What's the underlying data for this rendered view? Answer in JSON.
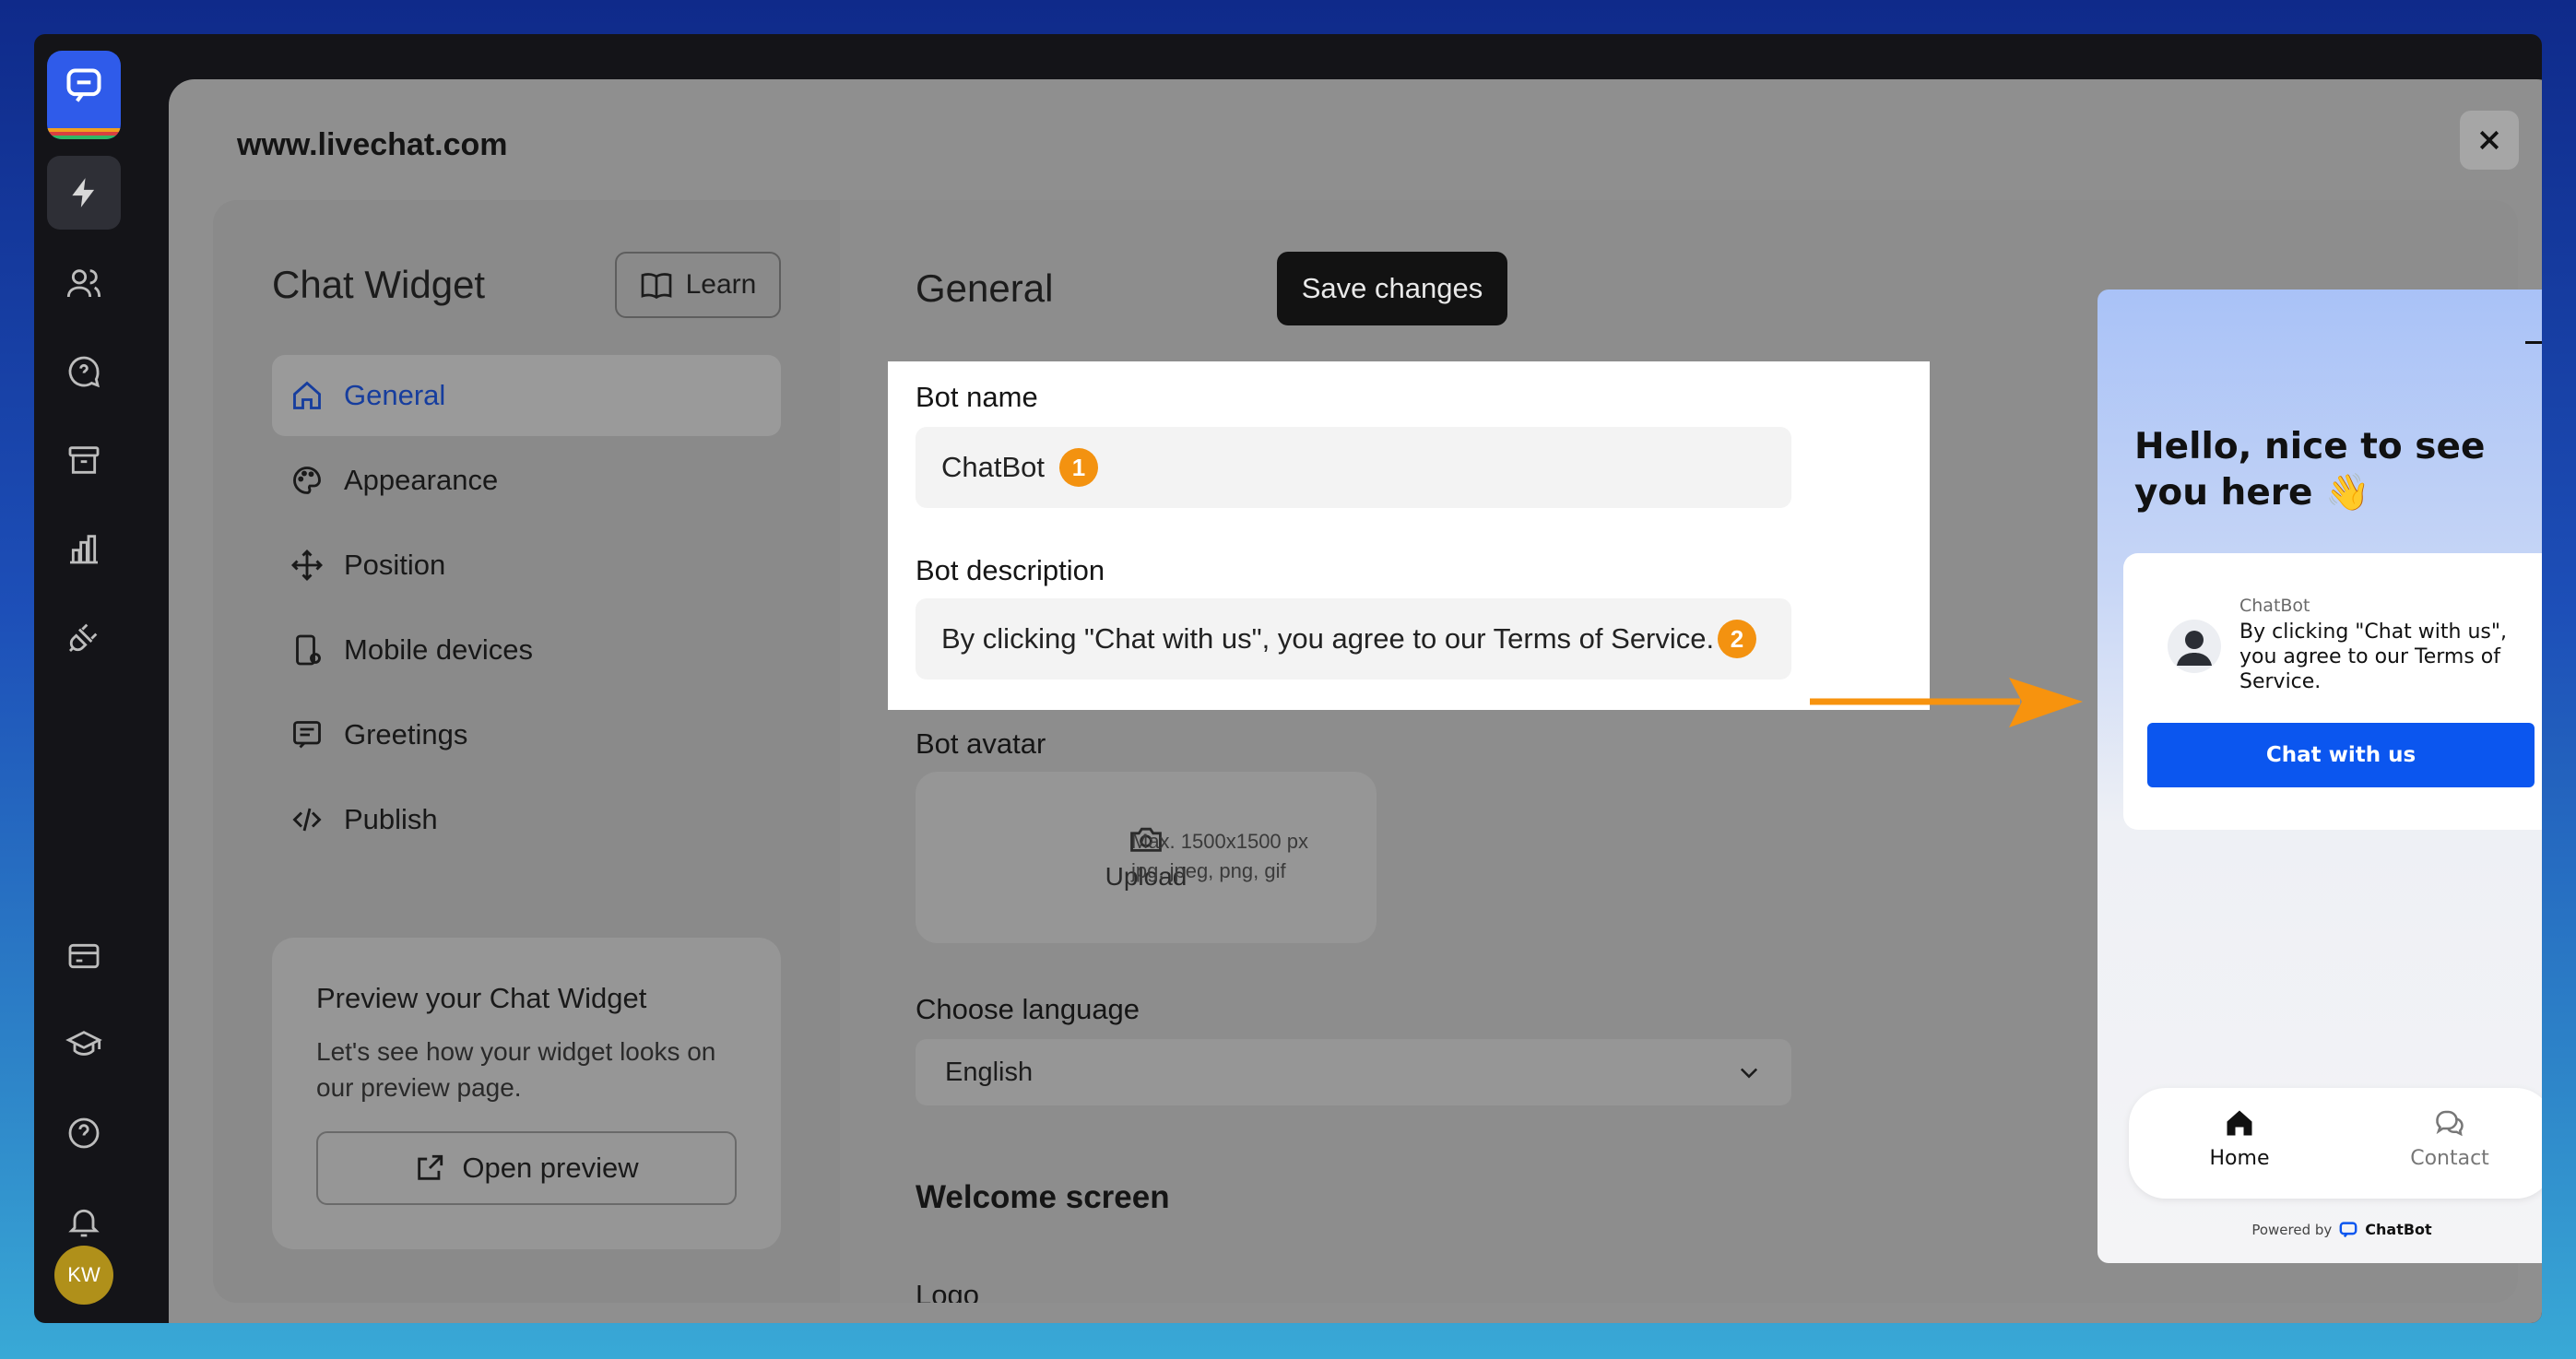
{
  "app": {
    "avatar_initials": "KW",
    "rail_icons": [
      "chatbot-logo-icon",
      "lightning-icon",
      "users-icon",
      "chat-question-icon",
      "archive-icon",
      "reports-icon",
      "plug-icon",
      "billing-icon",
      "education-icon",
      "help-icon",
      "bell-icon"
    ]
  },
  "modal": {
    "site": "www.livechat.com",
    "close_label": "✕"
  },
  "sidebar": {
    "title": "Chat Widget",
    "learn_label": "Learn",
    "items": [
      {
        "label": "General",
        "icon": "home-icon",
        "active": true
      },
      {
        "label": "Appearance",
        "icon": "palette-icon"
      },
      {
        "label": "Position",
        "icon": "move-icon"
      },
      {
        "label": "Mobile devices",
        "icon": "mobile-gear-icon"
      },
      {
        "label": "Greetings",
        "icon": "message-square-icon"
      },
      {
        "label": "Publish",
        "icon": "code-icon"
      }
    ],
    "preview": {
      "title": "Preview your Chat Widget",
      "text": "Let's see how your widget looks on our preview page.",
      "button": "Open preview"
    }
  },
  "main": {
    "heading": "General",
    "save_label": "Save changes",
    "bot_name_label": "Bot name",
    "bot_name_value": "ChatBot",
    "bot_name_badge": "1",
    "bot_desc_label": "Bot description",
    "bot_desc_value": "By clicking \"Chat with us\", you agree to our Terms of Service.",
    "bot_desc_badge": "2",
    "avatar_label": "Bot avatar",
    "upload_label": "Upload",
    "upload_hint_1": "Max. 1500x1500 px",
    "upload_hint_2": "jpg, jpeg, png, gif",
    "language_label": "Choose language",
    "language_value": "English",
    "welcome_heading": "Welcome screen",
    "logo_label": "Logo"
  },
  "widget": {
    "greeting": "Hello, nice to see you here 👋",
    "bot_name": "ChatBot",
    "bot_message": "By clicking \"Chat with us\", you agree to our Terms of Service.",
    "chat_button": "Chat with us",
    "tab_home": "Home",
    "tab_contact": "Contact",
    "powered_by": "Powered by",
    "brand": "ChatBot",
    "accent": "#0b56ef"
  },
  "colors": {
    "badge": "#f39210",
    "arrow": "#f7930e",
    "active_nav": "#163d9e"
  }
}
